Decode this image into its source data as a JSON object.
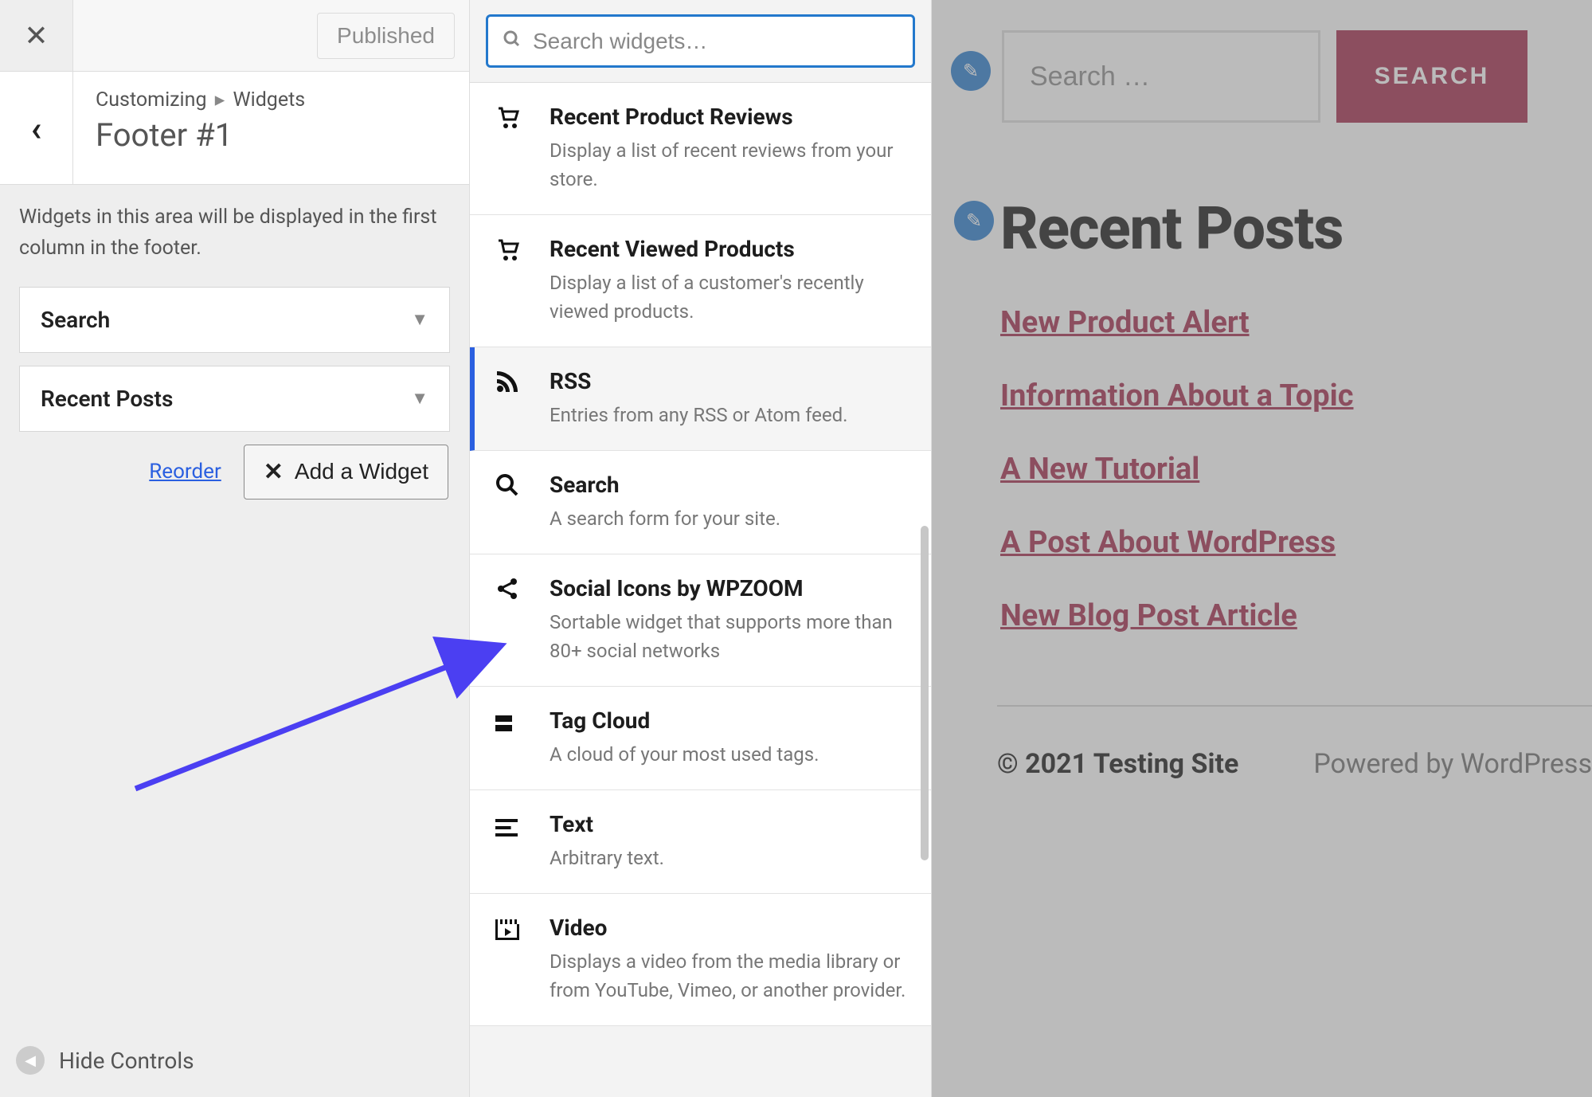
{
  "top": {
    "published_label": "Published"
  },
  "header": {
    "crumb_root": "Customizing",
    "crumb_parent": "Widgets",
    "section_title": "Footer #1"
  },
  "panel": {
    "description": "Widgets in this area will be displayed in the first column in the footer.",
    "reorder_label": "Reorder",
    "add_widget_label": "Add a Widget",
    "hide_controls_label": "Hide Controls",
    "slots": [
      {
        "title": "Search"
      },
      {
        "title": "Recent Posts"
      }
    ]
  },
  "picker": {
    "search_placeholder": "Search widgets…",
    "items": [
      {
        "icon": "cart-icon",
        "title": "Recent Product Reviews",
        "desc": "Display a list of recent reviews from your store."
      },
      {
        "icon": "cart-icon",
        "title": "Recent Viewed Products",
        "desc": "Display a list of a customer's recently viewed products."
      },
      {
        "icon": "rss-icon",
        "title": "RSS",
        "desc": "Entries from any RSS or Atom feed.",
        "hovered": true
      },
      {
        "icon": "search-icon",
        "title": "Search",
        "desc": "A search form for your site."
      },
      {
        "icon": "share-icon",
        "title": "Social Icons by WPZOOM",
        "desc": "Sortable widget that supports more than 80+ social networks"
      },
      {
        "icon": "tag-icon",
        "title": "Tag Cloud",
        "desc": "A cloud of your most used tags."
      },
      {
        "icon": "lines-icon",
        "title": "Text",
        "desc": "Arbitrary text."
      },
      {
        "icon": "video-icon",
        "title": "Video",
        "desc": "Displays a video from the media library or from YouTube, Vimeo, or another provider."
      }
    ]
  },
  "preview": {
    "search_placeholder": "Search …",
    "search_button": "SEARCH",
    "recent_posts_heading": "Recent Posts",
    "posts": [
      "New Product Alert",
      "Information About a Topic",
      "A New Tutorial",
      "A Post About WordPress",
      "New Blog Post Article"
    ],
    "footer_left": "© 2021 Testing Site",
    "footer_right": "Powered by WordPress"
  },
  "colors": {
    "accent_link": "#a02446",
    "customizer_blue": "#2378cc",
    "annotation_arrow": "#4b3ff2"
  }
}
